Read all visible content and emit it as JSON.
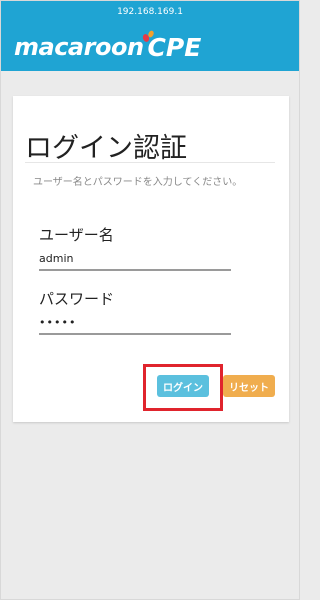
{
  "browser": {
    "url": "192.168.169.1"
  },
  "brand": {
    "name": "macaroon",
    "suffix": "CPE",
    "bar_color": "#1fa4d3"
  },
  "login": {
    "title": "ログイン認証",
    "subtitle": "ユーザー名とパスワードを入力してください。",
    "username_label": "ユーザー名",
    "username_value": "admin",
    "password_label": "パスワード",
    "password_value": "•••••",
    "login_button": "ログイン",
    "reset_button": "リセット",
    "login_button_color": "#5bc0de",
    "reset_button_color": "#f0ad4e"
  },
  "annotation": {
    "highlight_color": "#e0242d",
    "highlight_target": "login-button"
  }
}
